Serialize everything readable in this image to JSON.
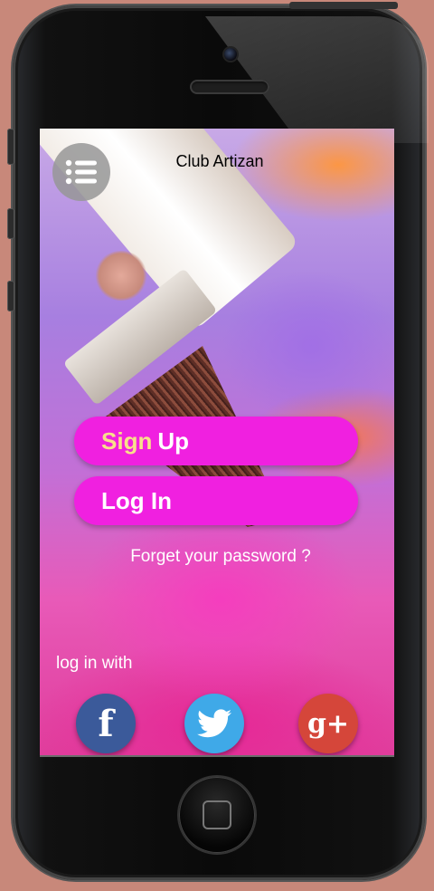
{
  "app": {
    "title": "Club Artizan"
  },
  "menu": {
    "icon": "list-menu-icon"
  },
  "actions": {
    "signup_part1": "Sign",
    "signup_part2": "Up",
    "login_label": "Log In",
    "forgot_label": "Forget your password ?"
  },
  "social": {
    "heading": "log in with",
    "items": [
      {
        "name": "Facebook",
        "icon": "facebook-icon",
        "glyph": "f",
        "color": "#3b5a9a"
      },
      {
        "name": "Twitter",
        "icon": "twitter-icon",
        "color": "#3fa9e8"
      },
      {
        "name": "Google Plus",
        "icon": "google-plus-icon",
        "glyph": "g+",
        "color": "#d5463a"
      }
    ]
  },
  "colors": {
    "button": "#f020e0",
    "signup_highlight": "#f8e08a",
    "background": "#c8887a"
  }
}
